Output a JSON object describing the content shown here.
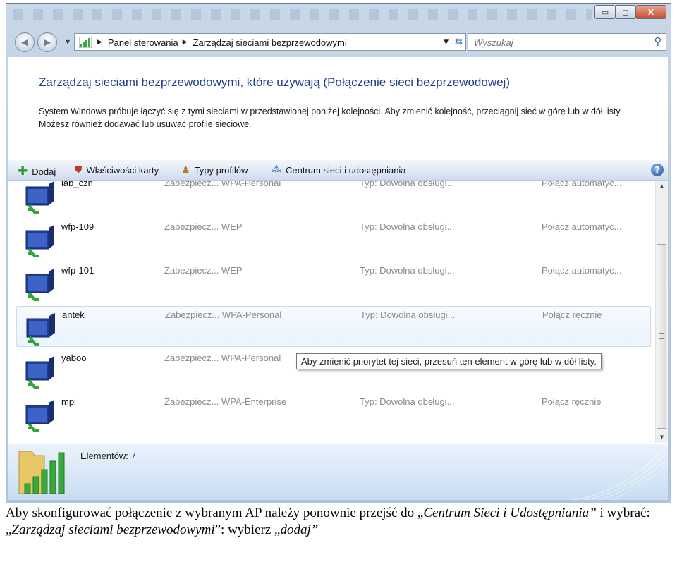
{
  "window": {
    "controls": {
      "minimize": "▭",
      "maximize": "◻",
      "close": "X"
    }
  },
  "address_bar": {
    "breadcrumbs": [
      "Panel sterowania",
      "Zarządzaj sieciami bezprzewodowymi"
    ],
    "search_placeholder": "Wyszukaj"
  },
  "header": {
    "title": "Zarządzaj sieciami bezprzewodowymi, które używają (Połączenie sieci bezprzewodowej)",
    "description": "System Windows próbuje łączyć się z tymi sieciami w przedstawionej poniżej kolejności. Aby zmienić kolejność, przeciągnij sieć w górę lub w dół listy. Możesz również dodawać lub usuwać profile sieciowe."
  },
  "toolbar": {
    "add_label": "Dodaj",
    "properties_label": "Właściwości karty",
    "profile_types_label": "Typy profilów",
    "network_center_label": "Centrum sieci i udostępniania"
  },
  "networks": [
    {
      "name": "lab_czn",
      "security": "Zabezpiecz... WPA-Personal",
      "type": "Typ: Dowolna obsługi...",
      "connect": "Połącz automatyc..."
    },
    {
      "name": "wfp-109",
      "security": "Zabezpiecz... WEP",
      "type": "Typ: Dowolna obsługi...",
      "connect": "Połącz automatyc..."
    },
    {
      "name": "wfp-101",
      "security": "Zabezpiecz... WEP",
      "type": "Typ: Dowolna obsługi...",
      "connect": "Połącz automatyc..."
    },
    {
      "name": "antek",
      "security": "Zabezpiecz... WPA-Personal",
      "type": "Typ: Dowolna obsługi...",
      "connect": "Połącz ręcznie"
    },
    {
      "name": "yaboo",
      "security": "Zabezpiecz... WPA-Personal",
      "type": "",
      "connect": ""
    },
    {
      "name": "mpi",
      "security": "Zabezpiecz... WPA-Enterprise",
      "type": "Typ: Dowolna obsługi...",
      "connect": "Połącz ręcznie"
    }
  ],
  "tooltip": "Aby zmienić priorytet tej sieci, przesuń ten element w górę lub w dół listy.",
  "details": {
    "items_count": "Elementów: 7"
  },
  "caption": {
    "part1": "Aby skonfigurować połączenie z wybranym AP należy ponownie przejść do „",
    "italic1": "Centrum Sieci i Udostępniania”",
    "part2": " i wybrać: „",
    "italic2": "Zarządzaj sieciami bezprzewodowymi",
    "part3": "”: wybierz „",
    "italic3": "dodaj”"
  },
  "colors": {
    "title_blue": "#1e3e8a",
    "signal_green": "#3aa83a"
  }
}
